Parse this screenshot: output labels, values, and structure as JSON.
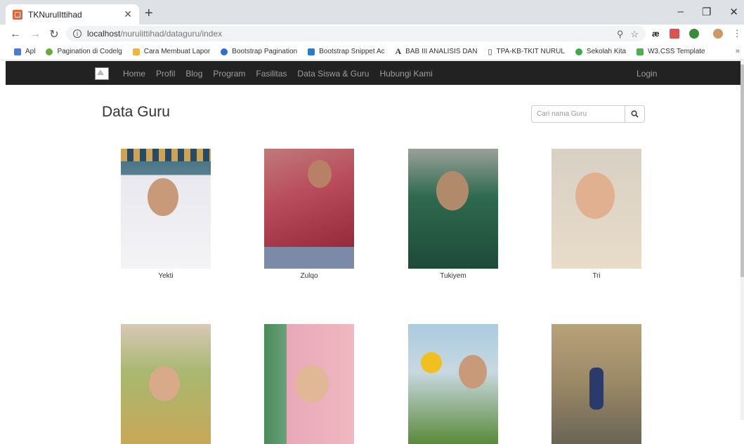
{
  "browser": {
    "tab_title": "TKNurulIttihad",
    "url_host": "localhost",
    "url_path": "/nurulittihad/dataguru/index",
    "bookmarks": [
      {
        "label": "Apl",
        "color": "#4a7bd8"
      },
      {
        "label": "Pagination di Codelg",
        "color": "#6aaa3a"
      },
      {
        "label": "Cara Membuat Lapor",
        "color": "#f2b632"
      },
      {
        "label": "Bootstrap Pagination",
        "color": "#2f6fd1"
      },
      {
        "label": "Bootstrap Snippet Ac",
        "color": "#2a7bd3"
      },
      {
        "label": "BAB III ANALISIS DAN",
        "color": "#222222"
      },
      {
        "label": "TPA-KB-TKIT NURUL",
        "color": "#888888"
      },
      {
        "label": "Sekolah Kita",
        "color": "#3aaa4a"
      },
      {
        "label": "W3.CSS Template",
        "color": "#4caf50"
      }
    ]
  },
  "nav": {
    "items": [
      "Home",
      "Profil",
      "Blog",
      "Program",
      "Fasilitas",
      "Data Siswa & Guru",
      "Hubungi Kami"
    ],
    "login": "Login"
  },
  "page": {
    "title": "Data Guru",
    "search_placeholder": "Cari nama Guru"
  },
  "teachers": [
    {
      "name": "Yekti",
      "photo": "teacher-photo-yekti"
    },
    {
      "name": "Zulqo",
      "photo": "teacher-photo-zulqo"
    },
    {
      "name": "Tukiyem",
      "photo": "teacher-photo-tukiyem"
    },
    {
      "name": "Tri",
      "photo": "teacher-photo-tri"
    },
    {
      "name": "",
      "photo": "teacher-photo-5"
    },
    {
      "name": "",
      "photo": "teacher-photo-6"
    },
    {
      "name": "",
      "photo": "teacher-photo-7"
    },
    {
      "name": "",
      "photo": "teacher-photo-8"
    }
  ]
}
